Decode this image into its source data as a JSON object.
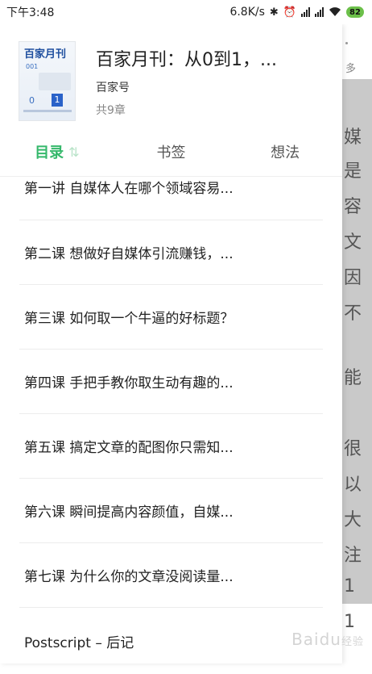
{
  "status_bar": {
    "time": "下午3:48",
    "network_speed": "6.8K/s",
    "battery": "82",
    "icons": [
      "bluetooth-icon",
      "alarm-icon",
      "signal-icon",
      "signal-icon",
      "wifi-icon",
      "battery-icon"
    ]
  },
  "book": {
    "cover_title": "百家月刊",
    "cover_number": "001",
    "cover_zero": "0",
    "cover_one": "1",
    "title": "百家月刊：从0到1，...",
    "author": "百家号",
    "chapter_count": "共9章"
  },
  "tabs": [
    {
      "label": "目录",
      "active": true
    },
    {
      "label": "书签",
      "active": false
    },
    {
      "label": "想法",
      "active": false
    }
  ],
  "chapters": [
    "第一讲 自媒体人在哪个领域容易...",
    "第二课 想做好自媒体引流赚钱，...",
    "第三课 如何取一个牛逼的好标题？",
    "第四课 手把手教你取生动有趣的...",
    "第五课 搞定文章的配图你只需知...",
    "第六课 瞬间提高内容颜值，自媒...",
    "第七课 为什么你的文章没阅读量...",
    "Postscript – 后记"
  ],
  "background_page": {
    "more_label": "多",
    "chars": [
      "媒",
      "是",
      "容",
      "文",
      "因",
      "不",
      "",
      "能",
      "",
      "很",
      "以",
      "大",
      "注",
      "1",
      "1"
    ]
  },
  "watermark": {
    "text": "Baidu",
    "suffix": "经验"
  },
  "colors": {
    "accent": "#35b86b",
    "cover_blue": "#2a62c9",
    "battery_green": "#6cc04a"
  }
}
